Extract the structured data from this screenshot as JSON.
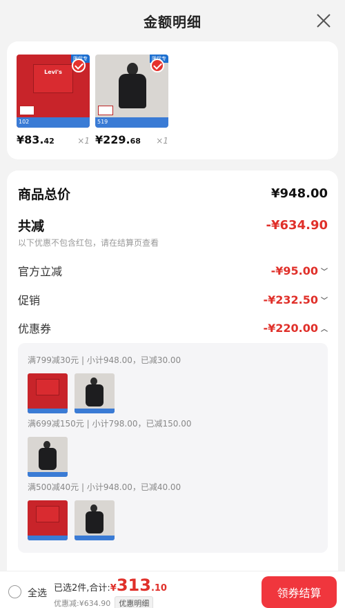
{
  "header": {
    "title": "金额明细"
  },
  "products": [
    {
      "price_int": "¥83.",
      "price_dec": "42",
      "qty": "×1",
      "badge": "限促专",
      "box_text": "Levi's",
      "strip_text": "102"
    },
    {
      "price_int": "¥229.",
      "price_dec": "68",
      "qty": "×1",
      "badge": "限促专",
      "strip_text": "519"
    }
  ],
  "detail": {
    "total_label": "商品总价",
    "total_value": "¥948.00",
    "reduce_label": "共减",
    "reduce_value": "-¥634.90",
    "reduce_note": "以下优惠不包含红包，请在结算页查看",
    "official_label": "官方立减",
    "official_value": "-¥95.00",
    "promo_label": "促销",
    "promo_value": "-¥232.50",
    "coupon_label": "优惠券",
    "coupon_value": "-¥220.00",
    "coupons": [
      {
        "text": "满799减30元 | 小计948.00，已减30.00"
      },
      {
        "text": "满699减150元 | 小计798.00，已减150.00"
      },
      {
        "text": "满500减40元 | 小计948.00，已减40.00"
      }
    ]
  },
  "footer": {
    "select_all": "全选",
    "selected_text": "已选2件,合计:",
    "total_symbol": "¥",
    "total_int": "313",
    "total_dec": ".10",
    "discount_text": "优惠减:¥634.90",
    "discount_detail_btn": "优惠明细",
    "checkout_btn": "领券结算"
  },
  "colors": {
    "accent": "#e0302a",
    "checkout": "#f0363d",
    "check": "#e5322d"
  }
}
